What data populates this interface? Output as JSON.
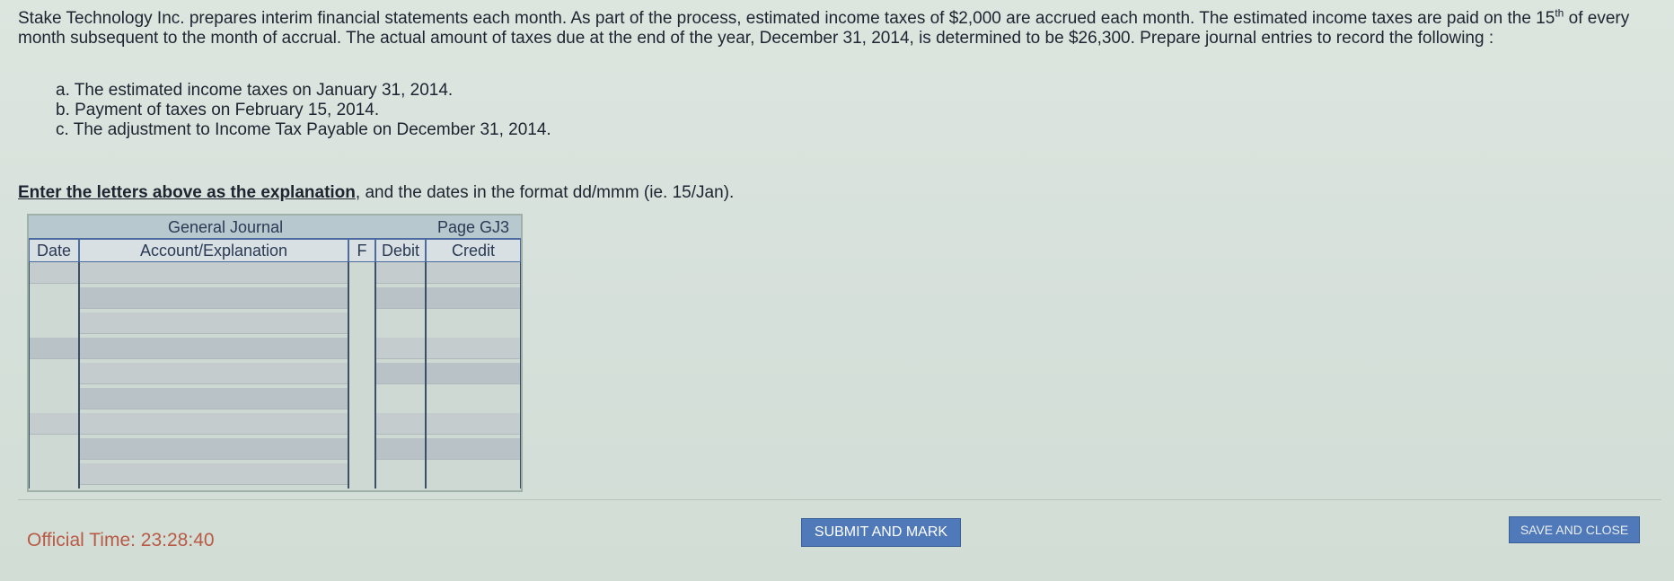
{
  "problem": {
    "text_before_sup": "Stake Technology Inc. prepares interim financial statements each month. As part of the process, estimated income taxes of $2,000 are accrued each month. The estimated income taxes are paid on the 15",
    "sup": "th",
    "text_after_sup": " of every month subsequent to the month of accrual. The actual amount of taxes due at the end of the year, December 31, 2014, is determined to be $26,300. Prepare journal entries to record the following :"
  },
  "items": [
    "a. The estimated income taxes on January 31, 2014.",
    "b. Payment of taxes on February 15, 2014.",
    "c. The adjustment to Income Tax Payable on December 31, 2014."
  ],
  "instruction": {
    "emphasis": "Enter the letters above as the explanation",
    "rest": ", and the dates in the format dd/mmm (ie. 15/Jan)."
  },
  "journal": {
    "title": "General Journal",
    "page": "Page GJ3",
    "columns": {
      "date": "Date",
      "account": "Account/Explanation",
      "f": "F",
      "debit": "Debit",
      "credit": "Credit"
    }
  },
  "footer": {
    "timer": "Official Time: 23:28:40",
    "submit_label": "SUBMIT AND MARK",
    "save_label": "SAVE AND CLOSE"
  },
  "colors": {
    "accent_button": "#4f79b8",
    "timer_text": "#b85a46"
  }
}
